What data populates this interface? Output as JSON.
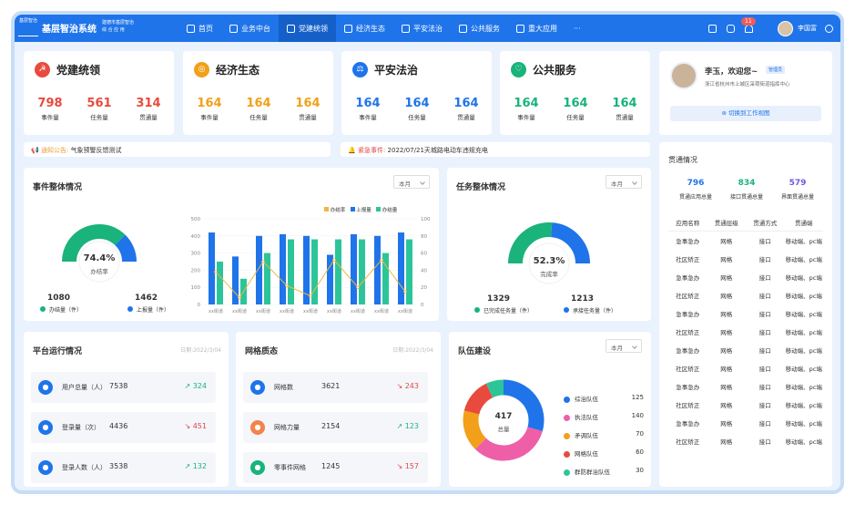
{
  "header": {
    "logo_text": "基层智治",
    "title": "基层智治系统",
    "subtitle_1": "建德市基层智治",
    "subtitle_2": "综 合 应 用",
    "nav": [
      {
        "label": "首页",
        "icon": "home-icon"
      },
      {
        "label": "业务中台",
        "icon": "business-icon"
      },
      {
        "label": "党建统领",
        "icon": "party-icon",
        "active": true
      },
      {
        "label": "经济生态",
        "icon": "economy-icon"
      },
      {
        "label": "平安法治",
        "icon": "shield-icon"
      },
      {
        "label": "公共服务",
        "icon": "service-icon"
      },
      {
        "label": "重大应用",
        "icon": "apps-icon"
      },
      {
        "label": "···",
        "icon": "more-icon"
      }
    ],
    "notification_count": "11",
    "username": "李国富"
  },
  "categories": [
    {
      "title": "党建统领",
      "icon": "party-flag-icon",
      "color": "#e84b3d",
      "values": [
        "798",
        "561",
        "314"
      ],
      "labels": [
        "事件量",
        "任务量",
        "贯通量"
      ]
    },
    {
      "title": "经济生态",
      "icon": "economy-icon",
      "color": "#f2a019",
      "values": [
        "164",
        "164",
        "164"
      ],
      "labels": [
        "事件量",
        "任务量",
        "贯通量"
      ]
    },
    {
      "title": "平安法治",
      "icon": "law-icon",
      "color": "#1f74ea",
      "values": [
        "164",
        "164",
        "164"
      ],
      "labels": [
        "事件量",
        "任务量",
        "贯通量"
      ]
    },
    {
      "title": "公共服务",
      "icon": "service-icon",
      "color": "#19b37b",
      "values": [
        "164",
        "164",
        "164"
      ],
      "labels": [
        "事件量",
        "任务量",
        "贯通量"
      ]
    }
  ],
  "notice": {
    "label": "通知公告:",
    "text": "气象预警反馈测试"
  },
  "emergency": {
    "label": "紧急事件:",
    "text": "2022/07/21天城路电动车违规充电"
  },
  "profile": {
    "greeting": "李玉，欢迎您~",
    "role": "管理员",
    "address": "浙江省杭州市上城区采荷街道指挥中心",
    "switch_label": "切换到工作视图"
  },
  "event_overview": {
    "title": "事件整体情况",
    "period": "本月",
    "percent": "74.4%",
    "percent_label": "办结率",
    "done": "1080",
    "done_label": "办结量（件）",
    "reported": "1462",
    "reported_label": "上报量（件）",
    "legend": [
      "办结率",
      "上报量",
      "办结量"
    ]
  },
  "task_overview": {
    "title": "任务整体情况",
    "period": "本月",
    "percent": "52.3%",
    "percent_label": "完成率",
    "completed": "1329",
    "completed_label": "已完成任务量（件）",
    "accepted": "1213",
    "accepted_label": "承接任务量（件）"
  },
  "chart_data": {
    "type": "bar",
    "categories": [
      "xx街道",
      "xx街道",
      "xx街道",
      "xx街道",
      "xx街道",
      "xx街道",
      "xx街道",
      "xx街道",
      "xx街道"
    ],
    "series": [
      {
        "name": "上报量",
        "type": "bar",
        "values": [
          420,
          280,
          400,
          410,
          400,
          290,
          410,
          400,
          420
        ]
      },
      {
        "name": "办结量",
        "type": "bar",
        "values": [
          250,
          150,
          300,
          380,
          380,
          380,
          380,
          300,
          380
        ]
      },
      {
        "name": "办结率",
        "type": "line",
        "axis": "right",
        "values": [
          38,
          8,
          50,
          22,
          10,
          52,
          20,
          52,
          15
        ]
      }
    ],
    "ylim": [
      0,
      500
    ],
    "y_ticks": [
      "500",
      "400",
      "300",
      "200",
      "100",
      "0"
    ],
    "y2lim": [
      0,
      100
    ],
    "y2_ticks": [
      "100",
      "80",
      "60",
      "40",
      "20",
      "0"
    ],
    "colors": {
      "上报量": "#1f74ea",
      "办结量": "#2cc59a",
      "办结率": "#f2b541"
    }
  },
  "platform": {
    "title": "平台运行情况",
    "date": "日期:2022/3/04",
    "rows": [
      {
        "label": "用户总量（人）",
        "value": "7538",
        "delta": "324",
        "trend": "up",
        "icon": "users-icon",
        "color": "#1f74ea"
      },
      {
        "label": "登录量（次）",
        "value": "4436",
        "delta": "451",
        "trend": "down",
        "icon": "chart-icon",
        "color": "#1f74ea"
      },
      {
        "label": "登录人数（人）",
        "value": "3538",
        "delta": "132",
        "trend": "up",
        "icon": "bar-icon",
        "color": "#1f74ea"
      }
    ]
  },
  "grid": {
    "title": "网格质态",
    "date": "日期:2022/3/04",
    "rows": [
      {
        "label": "网格数",
        "value": "3621",
        "delta": "243",
        "trend": "down",
        "icon": "cube-icon",
        "color": "#1f74ea"
      },
      {
        "label": "网格力量",
        "value": "2154",
        "delta": "123",
        "trend": "up",
        "icon": "person-icon",
        "color": "#f3834b"
      },
      {
        "label": "零事件网格",
        "value": "1245",
        "delta": "157",
        "trend": "down",
        "icon": "zero-grid-icon",
        "color": "#19b37b"
      }
    ]
  },
  "team": {
    "title": "队伍建设",
    "period": "本月",
    "total": "417",
    "total_label": "总量",
    "items": [
      {
        "name": "综治队伍",
        "value": 125,
        "color": "#1f74ea"
      },
      {
        "name": "执法队伍",
        "value": 140,
        "color": "#ee5fa8"
      },
      {
        "name": "矛调队伍",
        "value": 70,
        "color": "#f2a019"
      },
      {
        "name": "网格队伍",
        "value": 60,
        "color": "#e84b3d"
      },
      {
        "name": "群防群治队伍",
        "value": 30,
        "color": "#2cc59a"
      }
    ]
  },
  "connect": {
    "title": "贯通情况",
    "stats": [
      {
        "value": "796",
        "label": "贯通应用总量",
        "color": "#1f74ea"
      },
      {
        "value": "834",
        "label": "接口贯通总量",
        "color": "#19b37b"
      },
      {
        "value": "579",
        "label": "界面贯通总量",
        "color": "#6a5ae0"
      }
    ],
    "headers": [
      "应用名称",
      "贯通层级",
      "贯通方式",
      "贯通端"
    ],
    "rows": [
      [
        "急事急办",
        "网格",
        "接口",
        "移动端、pc端"
      ],
      [
        "社区矫正",
        "网格",
        "接口",
        "移动端、pc端"
      ],
      [
        "急事急办",
        "网格",
        "接口",
        "移动端、pc端"
      ],
      [
        "社区矫正",
        "网格",
        "接口",
        "移动端、pc端"
      ],
      [
        "急事急办",
        "网格",
        "接口",
        "移动端、pc端"
      ],
      [
        "社区矫正",
        "网格",
        "接口",
        "移动端、pc端"
      ],
      [
        "急事急办",
        "网格",
        "接口",
        "移动端、pc端"
      ],
      [
        "社区矫正",
        "网格",
        "接口",
        "移动端、pc端"
      ],
      [
        "急事急办",
        "网格",
        "接口",
        "移动端、pc端"
      ],
      [
        "社区矫正",
        "网格",
        "接口",
        "移动端、pc端"
      ],
      [
        "急事急办",
        "网格",
        "接口",
        "移动端、pc端"
      ],
      [
        "社区矫正",
        "网格",
        "接口",
        "移动端、pc端"
      ]
    ]
  }
}
